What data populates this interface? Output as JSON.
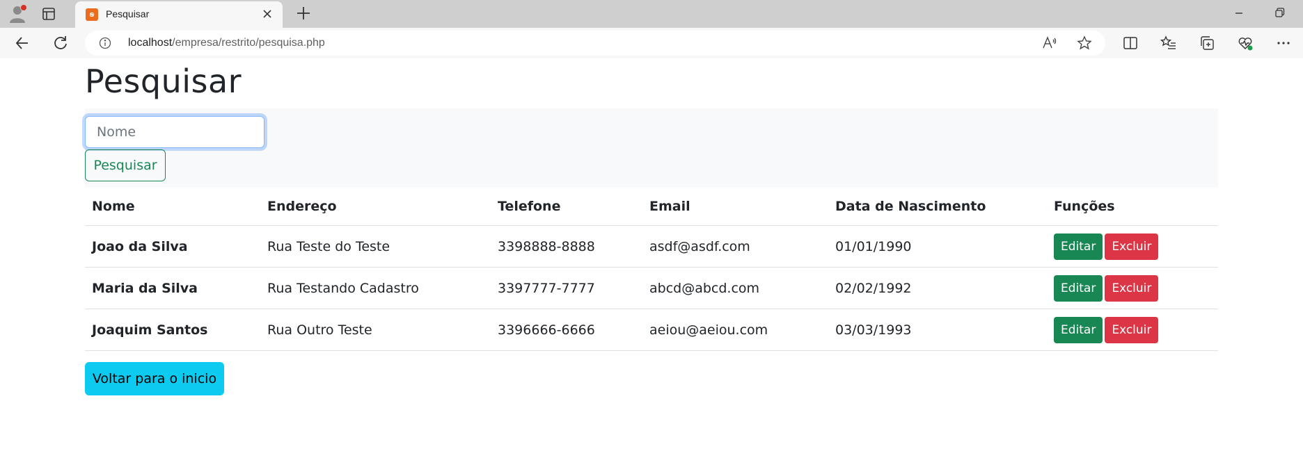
{
  "browser": {
    "tab_title": "Pesquisar",
    "url_host": "localhost",
    "url_path": "/empresa/restrito/pesquisa.php",
    "favicon_color": "#ea6c1f"
  },
  "page": {
    "title": "Pesquisar",
    "search": {
      "placeholder": "Nome",
      "value": "",
      "button_label": "Pesquisar"
    },
    "table": {
      "headers": [
        "Nome",
        "Endereço",
        "Telefone",
        "Email",
        "Data de Nascimento",
        "Funções"
      ],
      "rows": [
        {
          "nome": "Joao da Silva",
          "endereco": "Rua Teste do Teste",
          "telefone": "3398888-8888",
          "email": "asdf@asdf.com",
          "nascimento": "01/01/1990"
        },
        {
          "nome": "Maria da Silva",
          "endereco": "Rua Testando Cadastro",
          "telefone": "3397777-7777",
          "email": "abcd@abcd.com",
          "nascimento": "02/02/1992"
        },
        {
          "nome": "Joaquim Santos",
          "endereco": "Rua Outro Teste",
          "telefone": "3396666-6666",
          "email": "aeiou@aeiou.com",
          "nascimento": "03/03/1993"
        }
      ],
      "edit_label": "Editar",
      "delete_label": "Excluir"
    },
    "back_button_label": "Voltar para o inicio"
  },
  "colors": {
    "success": "#198754",
    "danger": "#dc3545",
    "info": "#0dcaf0",
    "panel_bg": "#f8f9fa"
  }
}
